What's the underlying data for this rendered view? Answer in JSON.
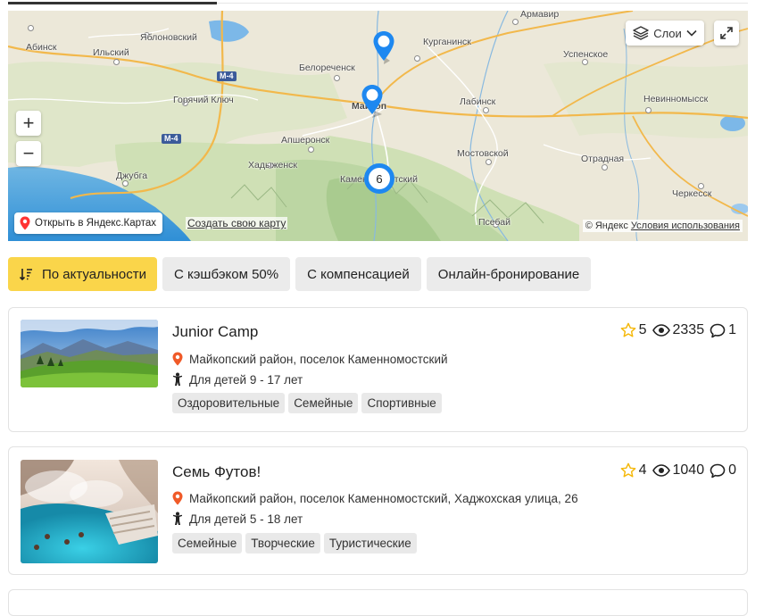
{
  "map": {
    "layers_label": "Слои",
    "open_yandex_label": "Открыть в Яндекс.Картах",
    "create_map_label": "Создать свою карту",
    "copyright_label": "© Яндекс",
    "terms_label": "Условия использования",
    "cluster_count": "6",
    "road_labels": [
      "M-4",
      "M-4"
    ],
    "cities": [
      "Армавир",
      "Абинск",
      "Ильский",
      "Яблоновский",
      "Курганинск",
      "Успенское",
      "Белореченск",
      "Майкоп",
      "Горячий Ключ",
      "Лабинск",
      "Невинномысск",
      "Апшеронск",
      "Мостовской",
      "Хадыженск",
      "Отрадная",
      "Джубга",
      "Каменномостский",
      "Черкесск",
      "Псебай"
    ],
    "zoom_in": "+",
    "zoom_out": "−",
    "accent": "#1e88f0"
  },
  "filters": [
    {
      "label": "По актуальности",
      "active": true
    },
    {
      "label": "С кэшбэком 50%",
      "active": false
    },
    {
      "label": "С компенсацией",
      "active": false
    },
    {
      "label": "Онлайн-бронирование",
      "active": false
    }
  ],
  "cards": [
    {
      "title": "Junior Camp",
      "address": "Майкопский район, поселок Каменномостский",
      "age": "Для детей 9 - 17 лет",
      "tags": [
        "Оздоровительные",
        "Семейные",
        "Спортивные"
      ],
      "rating": "5",
      "views": "2335",
      "comments": "1"
    },
    {
      "title": "Семь Футов!",
      "address": "Майкопский район, поселок Каменномостский, Хаджохская улица, 26",
      "age": "Для детей 5 - 18 лет",
      "tags": [
        "Семейные",
        "Творческие",
        "Туристические"
      ],
      "rating": "4",
      "views": "1040",
      "comments": "0"
    }
  ],
  "colors": {
    "active_chip": "#fad54a",
    "chip": "#ebebeb",
    "pin": "#1e88f0",
    "location_pin": "#f05a28",
    "star": "#f5b80a"
  }
}
